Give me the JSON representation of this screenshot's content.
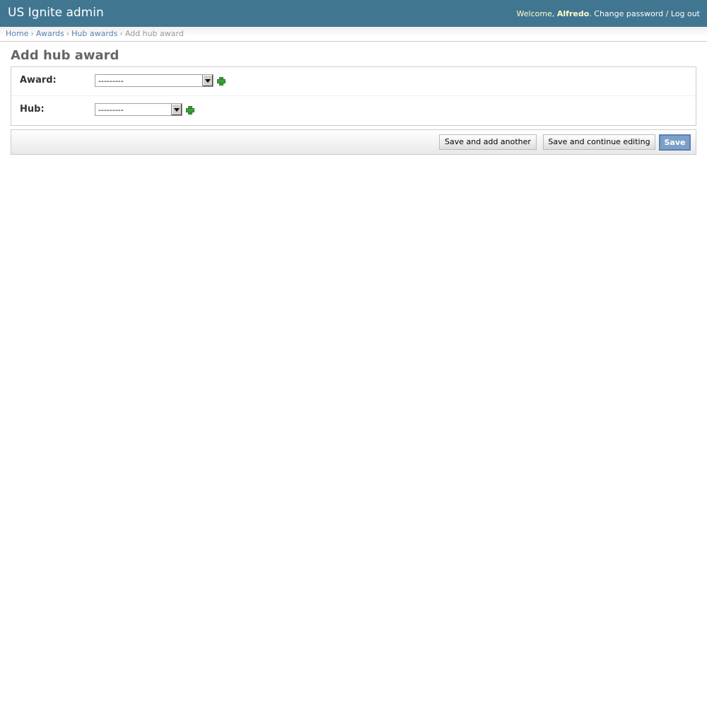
{
  "header": {
    "site_name": "US Ignite admin",
    "welcome_label": "Welcome,",
    "username": "Alfredo",
    "username_suffix": ".",
    "change_password": "Change password",
    "separator": "/",
    "log_out": "Log out"
  },
  "breadcrumbs": {
    "items": [
      "Home",
      "Awards",
      "Hub awards"
    ],
    "current": "Add hub award",
    "separator": "›"
  },
  "page": {
    "title": "Add hub award"
  },
  "form": {
    "fields": [
      {
        "label": "Award:",
        "value": "---------",
        "icon": "add-icon"
      },
      {
        "label": "Hub:",
        "value": "---------",
        "icon": "add-icon"
      }
    ]
  },
  "submit_row": {
    "save_add_another": "Save and add another",
    "save_continue": "Save and continue editing",
    "save": "Save"
  },
  "colors": {
    "header_bg": "#417690",
    "link": "#5b80b2",
    "save_button": "#7ca0c7"
  }
}
